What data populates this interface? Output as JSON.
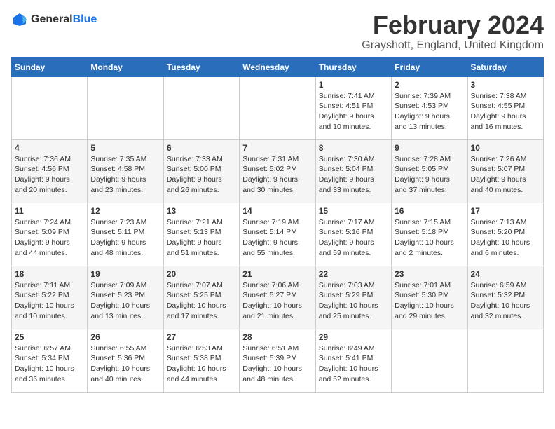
{
  "logo": {
    "general": "General",
    "blue": "Blue",
    "icon": "▶"
  },
  "title": "February 2024",
  "subtitle": "Grayshott, England, United Kingdom",
  "headers": [
    "Sunday",
    "Monday",
    "Tuesday",
    "Wednesday",
    "Thursday",
    "Friday",
    "Saturday"
  ],
  "weeks": [
    [
      {
        "day": "",
        "info": ""
      },
      {
        "day": "",
        "info": ""
      },
      {
        "day": "",
        "info": ""
      },
      {
        "day": "",
        "info": ""
      },
      {
        "day": "1",
        "info": "Sunrise: 7:41 AM\nSunset: 4:51 PM\nDaylight: 9 hours\nand 10 minutes."
      },
      {
        "day": "2",
        "info": "Sunrise: 7:39 AM\nSunset: 4:53 PM\nDaylight: 9 hours\nand 13 minutes."
      },
      {
        "day": "3",
        "info": "Sunrise: 7:38 AM\nSunset: 4:55 PM\nDaylight: 9 hours\nand 16 minutes."
      }
    ],
    [
      {
        "day": "4",
        "info": "Sunrise: 7:36 AM\nSunset: 4:56 PM\nDaylight: 9 hours\nand 20 minutes."
      },
      {
        "day": "5",
        "info": "Sunrise: 7:35 AM\nSunset: 4:58 PM\nDaylight: 9 hours\nand 23 minutes."
      },
      {
        "day": "6",
        "info": "Sunrise: 7:33 AM\nSunset: 5:00 PM\nDaylight: 9 hours\nand 26 minutes."
      },
      {
        "day": "7",
        "info": "Sunrise: 7:31 AM\nSunset: 5:02 PM\nDaylight: 9 hours\nand 30 minutes."
      },
      {
        "day": "8",
        "info": "Sunrise: 7:30 AM\nSunset: 5:04 PM\nDaylight: 9 hours\nand 33 minutes."
      },
      {
        "day": "9",
        "info": "Sunrise: 7:28 AM\nSunset: 5:05 PM\nDaylight: 9 hours\nand 37 minutes."
      },
      {
        "day": "10",
        "info": "Sunrise: 7:26 AM\nSunset: 5:07 PM\nDaylight: 9 hours\nand 40 minutes."
      }
    ],
    [
      {
        "day": "11",
        "info": "Sunrise: 7:24 AM\nSunset: 5:09 PM\nDaylight: 9 hours\nand 44 minutes."
      },
      {
        "day": "12",
        "info": "Sunrise: 7:23 AM\nSunset: 5:11 PM\nDaylight: 9 hours\nand 48 minutes."
      },
      {
        "day": "13",
        "info": "Sunrise: 7:21 AM\nSunset: 5:13 PM\nDaylight: 9 hours\nand 51 minutes."
      },
      {
        "day": "14",
        "info": "Sunrise: 7:19 AM\nSunset: 5:14 PM\nDaylight: 9 hours\nand 55 minutes."
      },
      {
        "day": "15",
        "info": "Sunrise: 7:17 AM\nSunset: 5:16 PM\nDaylight: 9 hours\nand 59 minutes."
      },
      {
        "day": "16",
        "info": "Sunrise: 7:15 AM\nSunset: 5:18 PM\nDaylight: 10 hours\nand 2 minutes."
      },
      {
        "day": "17",
        "info": "Sunrise: 7:13 AM\nSunset: 5:20 PM\nDaylight: 10 hours\nand 6 minutes."
      }
    ],
    [
      {
        "day": "18",
        "info": "Sunrise: 7:11 AM\nSunset: 5:22 PM\nDaylight: 10 hours\nand 10 minutes."
      },
      {
        "day": "19",
        "info": "Sunrise: 7:09 AM\nSunset: 5:23 PM\nDaylight: 10 hours\nand 13 minutes."
      },
      {
        "day": "20",
        "info": "Sunrise: 7:07 AM\nSunset: 5:25 PM\nDaylight: 10 hours\nand 17 minutes."
      },
      {
        "day": "21",
        "info": "Sunrise: 7:06 AM\nSunset: 5:27 PM\nDaylight: 10 hours\nand 21 minutes."
      },
      {
        "day": "22",
        "info": "Sunrise: 7:03 AM\nSunset: 5:29 PM\nDaylight: 10 hours\nand 25 minutes."
      },
      {
        "day": "23",
        "info": "Sunrise: 7:01 AM\nSunset: 5:30 PM\nDaylight: 10 hours\nand 29 minutes."
      },
      {
        "day": "24",
        "info": "Sunrise: 6:59 AM\nSunset: 5:32 PM\nDaylight: 10 hours\nand 32 minutes."
      }
    ],
    [
      {
        "day": "25",
        "info": "Sunrise: 6:57 AM\nSunset: 5:34 PM\nDaylight: 10 hours\nand 36 minutes."
      },
      {
        "day": "26",
        "info": "Sunrise: 6:55 AM\nSunset: 5:36 PM\nDaylight: 10 hours\nand 40 minutes."
      },
      {
        "day": "27",
        "info": "Sunrise: 6:53 AM\nSunset: 5:38 PM\nDaylight: 10 hours\nand 44 minutes."
      },
      {
        "day": "28",
        "info": "Sunrise: 6:51 AM\nSunset: 5:39 PM\nDaylight: 10 hours\nand 48 minutes."
      },
      {
        "day": "29",
        "info": "Sunrise: 6:49 AM\nSunset: 5:41 PM\nDaylight: 10 hours\nand 52 minutes."
      },
      {
        "day": "",
        "info": ""
      },
      {
        "day": "",
        "info": ""
      }
    ]
  ]
}
